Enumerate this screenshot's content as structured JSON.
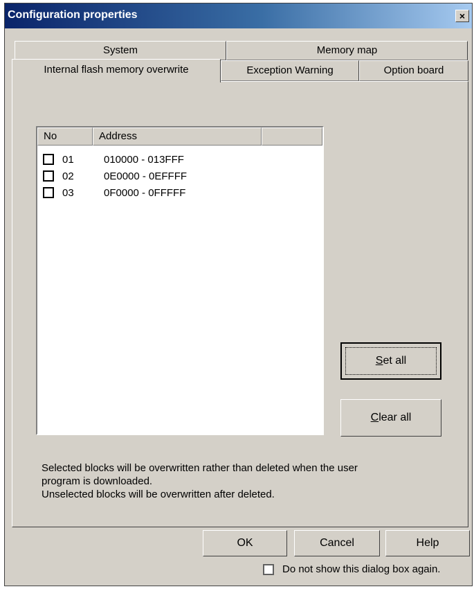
{
  "window": {
    "title": "Configuration properties",
    "close_label": "×"
  },
  "tabs": {
    "row1": [
      {
        "label": "System"
      },
      {
        "label": "Memory map"
      }
    ],
    "row2": [
      {
        "label": "Internal flash memory overwrite"
      },
      {
        "label": "Exception Warning"
      },
      {
        "label": "Option board"
      }
    ],
    "active": "Internal flash memory overwrite"
  },
  "list": {
    "columns": [
      "No",
      "Address"
    ],
    "rows": [
      {
        "no": "01",
        "address": "010000 - 013FFF",
        "checked": false
      },
      {
        "no": "02",
        "address": "0E0000 - 0EFFFF",
        "checked": false
      },
      {
        "no": "03",
        "address": "0F0000 - 0FFFFF",
        "checked": false
      }
    ]
  },
  "buttons": {
    "set_all_pre": "",
    "set_all_mnemonic": "S",
    "set_all_post": "et all",
    "clear_all_pre": "",
    "clear_all_mnemonic": "C",
    "clear_all_post": "lear all",
    "ok": "OK",
    "cancel": "Cancel",
    "help": "Help"
  },
  "info": {
    "line1": "Selected blocks will be overwritten rather than deleted when the user",
    "line2": "program is downloaded.",
    "line3": "Unselected blocks will be overwritten after deleted."
  },
  "footer": {
    "dont_show_label": "Do not show this dialog box again.",
    "dont_show_checked": false
  }
}
